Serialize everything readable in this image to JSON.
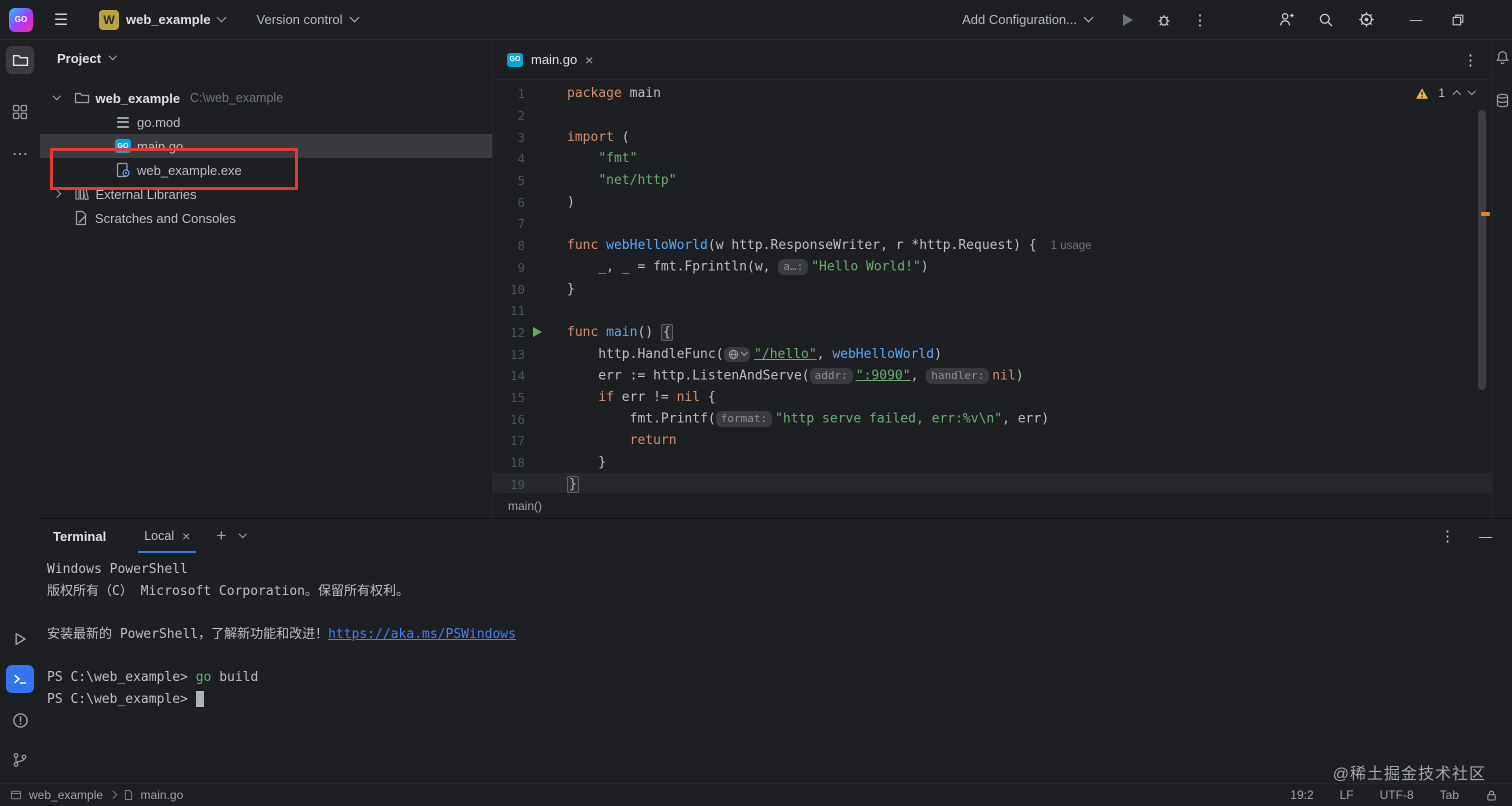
{
  "icons": {
    "close": "×",
    "more": "⋮",
    "minimize": "—",
    "plus": "+",
    "hamburger": "☰",
    "ellipsis": "⋯"
  },
  "colors": {
    "accent": "#3574f0",
    "annotation_red": "#e53935",
    "warning_yellow": "#e8b54a",
    "run_green": "#5fad65"
  },
  "titlebar": {
    "project_name": "web_example",
    "version_control": "Version control",
    "add_configuration": "Add Configuration..."
  },
  "project_panel": {
    "title": "Project",
    "tree": [
      {
        "id": "web-example-root",
        "name": "web_example",
        "suffix": "C:\\web_example",
        "icon": "folder",
        "chevron": "down",
        "indent": 0,
        "root": true
      },
      {
        "id": "go-mod",
        "name": "go.mod",
        "icon": "gomod",
        "indent": 1
      },
      {
        "id": "main-go",
        "name": "main.go",
        "icon": "go",
        "indent": 1,
        "selected": true
      },
      {
        "id": "web-example-exe",
        "name": "web_example.exe",
        "icon": "exe",
        "indent": 1
      },
      {
        "id": "external-libraries",
        "name": "External Libraries",
        "icon": "lib",
        "chevron": "right",
        "indent": 0
      },
      {
        "id": "scratches-and-consoles",
        "name": "Scratches and Consoles",
        "icon": "scratch",
        "indent": 0
      }
    ]
  },
  "editor": {
    "tab": {
      "title": "main.go"
    },
    "warnings": {
      "count": "1"
    },
    "breadcrumb": "main()",
    "code": [
      {
        "n": 1,
        "tokens": [
          {
            "t": "package",
            "c": "k"
          },
          {
            "t": " main",
            "c": "d"
          }
        ]
      },
      {
        "n": 2,
        "tokens": []
      },
      {
        "n": 3,
        "tokens": [
          {
            "t": "import",
            "c": "k"
          },
          {
            "t": " (",
            "c": "d"
          }
        ]
      },
      {
        "n": 4,
        "tokens": [
          {
            "t": "    ",
            "c": "d"
          },
          {
            "t": "\"fmt\"",
            "c": "s"
          }
        ]
      },
      {
        "n": 5,
        "tokens": [
          {
            "t": "    ",
            "c": "d"
          },
          {
            "t": "\"net/http\"",
            "c": "s"
          }
        ]
      },
      {
        "n": 6,
        "tokens": [
          {
            "t": ")",
            "c": "d"
          }
        ]
      },
      {
        "n": 7,
        "tokens": []
      },
      {
        "n": 8,
        "tokens": [
          {
            "t": "func",
            "c": "k"
          },
          {
            "t": " ",
            "c": "d"
          },
          {
            "t": "webHelloWorld",
            "c": "f"
          },
          {
            "t": "(w http.ResponseWriter, r *http.Request) {",
            "c": "d"
          },
          {
            "t": "1 usage",
            "c": "u"
          }
        ]
      },
      {
        "n": 9,
        "tokens": [
          {
            "t": "    _, _ = fmt.Fprintln(w, ",
            "c": "d"
          },
          {
            "t": "a…:",
            "c": "h"
          },
          {
            "t": "\"Hello World!\"",
            "c": "s"
          },
          {
            "t": ")",
            "c": "d"
          }
        ]
      },
      {
        "n": 10,
        "tokens": [
          {
            "t": "}",
            "c": "d"
          }
        ]
      },
      {
        "n": 11,
        "tokens": []
      },
      {
        "n": 12,
        "run": true,
        "tokens": [
          {
            "t": "func",
            "c": "k"
          },
          {
            "t": " ",
            "c": "d"
          },
          {
            "t": "main",
            "c": "f"
          },
          {
            "t": "() ",
            "c": "d"
          },
          {
            "t": "{",
            "c": "bx"
          }
        ]
      },
      {
        "n": 13,
        "tokens": [
          {
            "t": "    http.HandleFunc(",
            "c": "d"
          },
          {
            "c": "globe"
          },
          {
            "t": "\"/hello\"",
            "c": "sl"
          },
          {
            "t": ", ",
            "c": "d"
          },
          {
            "t": "webHelloWorld",
            "c": "f"
          },
          {
            "t": ")",
            "c": "d"
          }
        ]
      },
      {
        "n": 14,
        "tokens": [
          {
            "t": "    err := http.ListenAndServe(",
            "c": "d"
          },
          {
            "t": "addr:",
            "c": "h"
          },
          {
            "t": "\":9090\"",
            "c": "sl"
          },
          {
            "t": ", ",
            "c": "d"
          },
          {
            "t": "handler:",
            "c": "h"
          },
          {
            "t": "nil",
            "c": "k"
          },
          {
            "t": ")",
            "c": "d"
          }
        ]
      },
      {
        "n": 15,
        "tokens": [
          {
            "t": "    ",
            "c": "d"
          },
          {
            "t": "if",
            "c": "k"
          },
          {
            "t": " err != ",
            "c": "d"
          },
          {
            "t": "nil",
            "c": "k"
          },
          {
            "t": " {",
            "c": "d"
          }
        ]
      },
      {
        "n": 16,
        "tokens": [
          {
            "t": "        fmt.Printf(",
            "c": "d"
          },
          {
            "t": "format:",
            "c": "h"
          },
          {
            "t": "\"http serve failed, err:%v\\n\"",
            "c": "s"
          },
          {
            "t": ", err)",
            "c": "d"
          }
        ]
      },
      {
        "n": 17,
        "tokens": [
          {
            "t": "        ",
            "c": "d"
          },
          {
            "t": "return",
            "c": "k"
          }
        ]
      },
      {
        "n": 18,
        "tokens": [
          {
            "t": "    }",
            "c": "d"
          }
        ]
      },
      {
        "n": 19,
        "caret": true,
        "tokens": [
          {
            "t": "}",
            "c": "bx"
          }
        ]
      }
    ]
  },
  "terminal": {
    "title": "Terminal",
    "tab": "Local",
    "lines": [
      [
        {
          "t": "Windows PowerShell",
          "c": "d"
        }
      ],
      [
        {
          "t": "版权所有（C） Microsoft Corporation。保留所有权利。",
          "c": "d"
        }
      ],
      [],
      [
        {
          "t": "安装最新的 PowerShell，了解新功能和改进！",
          "c": "d"
        },
        {
          "t": "https://aka.ms/PSWindows",
          "c": "link"
        }
      ],
      [],
      [
        {
          "t": "PS C:\\web_example> ",
          "c": "d"
        },
        {
          "t": "go",
          "c": "cmd"
        },
        {
          "t": " build",
          "c": "d"
        }
      ],
      [
        {
          "t": "PS C:\\web_example> ",
          "c": "d"
        },
        {
          "c": "cursor"
        }
      ]
    ]
  },
  "status_bar": {
    "left": {
      "project": "web_example",
      "file": "main.go"
    },
    "right": [
      "19:2",
      "LF",
      "UTF-8",
      "Tab"
    ]
  },
  "watermark": "@稀土掘金技术社区"
}
